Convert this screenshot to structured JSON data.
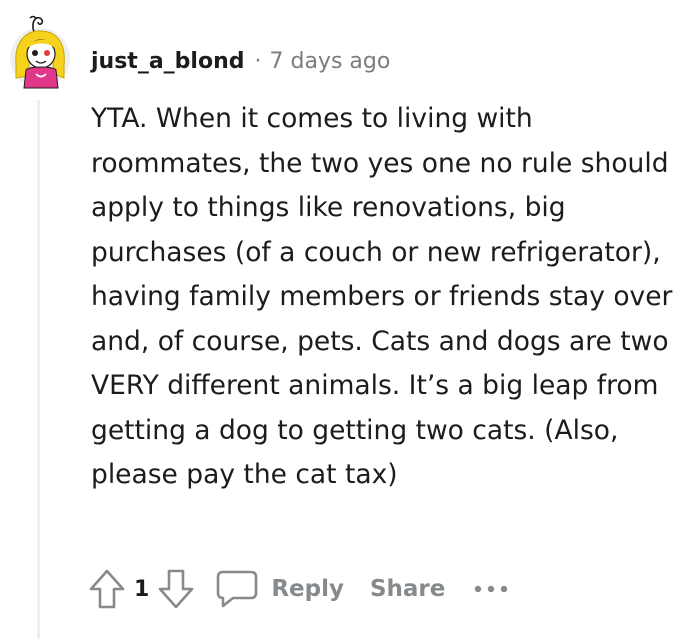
{
  "comment": {
    "author": "just_a_blond",
    "separator": "·",
    "time_ago": "7 days ago",
    "body": "YTA. When it comes to living with roommates, the two yes one no rule should apply to things like renovations, big purchases (of a couch or new refrigerator), having family members or friends stay over and, of course, pets. Cats and dogs are two VERY different animals. It’s a big leap from getting a dog to getting two cats. (Also, please pay the cat tax)"
  },
  "actions": {
    "vote_count": "1",
    "reply_label": "Reply",
    "share_label": "Share",
    "upvote_icon": "arrow-up-outline-icon",
    "downvote_icon": "arrow-down-outline-icon",
    "comment_icon": "speech-bubble-icon",
    "more_icon": "three-dots-icon"
  },
  "colors": {
    "text": "#1c1c1c",
    "meta": "#7c7c7c",
    "action": "#878a8c",
    "thread_line": "#edeff1",
    "avatar_hair": "#f7d21c",
    "avatar_shirt": "#e0378a"
  }
}
